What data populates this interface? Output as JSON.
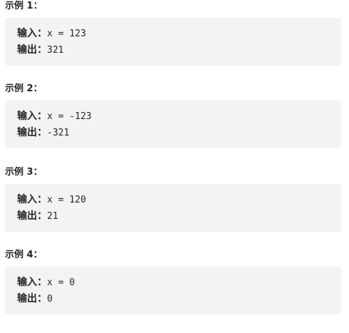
{
  "examples": [
    {
      "title": "示例 1：",
      "input_label": "输入：",
      "input_value": "x = 123",
      "output_label": "输出：",
      "output_value": "321"
    },
    {
      "title": "示例 2：",
      "input_label": "输入：",
      "input_value": "x = -123",
      "output_label": "输出：",
      "output_value": "-321"
    },
    {
      "title": "示例 3：",
      "input_label": "输入：",
      "input_value": "x = 120",
      "output_label": "输出：",
      "output_value": "21"
    },
    {
      "title": "示例 4：",
      "input_label": "输入：",
      "input_value": "x = 0",
      "output_label": "输出：",
      "output_value": "0"
    }
  ]
}
